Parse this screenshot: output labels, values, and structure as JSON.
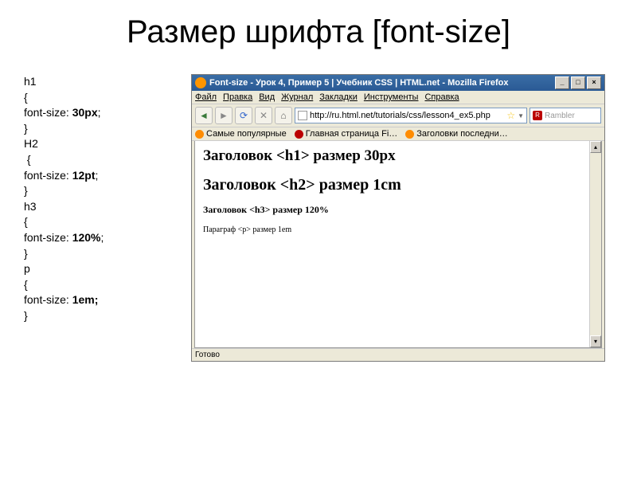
{
  "slide": {
    "title": "Размер шрифта [font-size]"
  },
  "code": {
    "l1": "h1",
    "l2": "{",
    "l3a": "font-size: ",
    "l3b": "30px",
    "l3c": ";",
    "l4": "}",
    "l5": "H2",
    "l6": " {",
    "l7a": "font-size: ",
    "l7b": "12pt",
    "l7c": ";",
    "l8": "}",
    "l9": "h3",
    "l10": "{",
    "l11a": "font-size: ",
    "l11b": "120%",
    "l11c": ";",
    "l12": "}",
    "l13": "p",
    "l14": "{",
    "l15a": "font-size: ",
    "l15b": "1em;",
    "l16": "}"
  },
  "browser": {
    "title": "Font-size - Урок 4, Пример 5 | Учебник CSS | HTML.net - Mozilla Firefox",
    "menu": {
      "file": "Файл",
      "edit": "Правка",
      "view": "Вид",
      "history": "Журнал",
      "bookmarks": "Закладки",
      "tools": "Инструменты",
      "help": "Справка"
    },
    "url": "http://ru.html.net/tutorials/css/lesson4_ex5.php",
    "search_placeholder": "Rambler",
    "bookmarks_bar": {
      "b1": "Самые популярные",
      "b2": "Главная страница Fi…",
      "b3": "Заголовки последни…"
    },
    "page": {
      "h1": "Заголовок <h1> размер 30px",
      "h2": "Заголовок <h2> размер 1cm",
      "h3": "Заголовок <h3> размер 120%",
      "p": "Параграф <p> размер 1em"
    },
    "status": "Готово"
  }
}
